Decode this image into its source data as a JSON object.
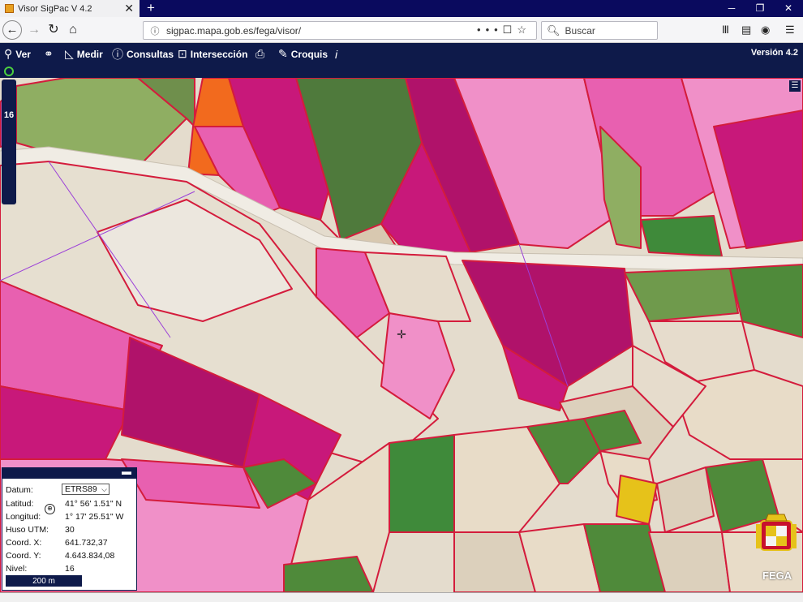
{
  "browser": {
    "tab_title": "Visor SigPac V 4.2",
    "tab_close": "✕",
    "new_tab": "+",
    "url": "sigpac.mapa.gob.es/fega/visor/",
    "search_placeholder": "Buscar",
    "window_controls": [
      "─",
      "❐",
      "✕"
    ]
  },
  "toolbar": {
    "items": [
      {
        "label": "Ver",
        "icon": "search-icon"
      },
      {
        "label": "",
        "icon": "binoculars-icon"
      },
      {
        "label": "Medir",
        "icon": "measure-icon"
      },
      {
        "label": "Consultas",
        "icon": "info-icon"
      },
      {
        "label": "Intersección",
        "icon": "intersection-icon"
      },
      {
        "label": "",
        "icon": "print-icon"
      },
      {
        "label": "Croquis",
        "icon": "pencil-icon"
      },
      {
        "label": "",
        "icon": "italic-info-icon"
      }
    ],
    "version": "Versión 4.2"
  },
  "map": {
    "zoom_level": "16",
    "colors": {
      "parcel_border": "#d41c3c",
      "magenta": "#c8187a",
      "pink": "#e860b0",
      "light_pink": "#f090c8",
      "orange": "#f26a1e",
      "yellow": "#e6c21a",
      "green": "#4f8a3a",
      "beige": "#e8dcc8"
    }
  },
  "coords": {
    "datum_label": "Datum:",
    "datum_value": "ETRS89",
    "lat_label": "Latitud:",
    "lat_value": "41° 56' 1.51\" N",
    "lon_label": "Longitud:",
    "lon_value": "1° 17' 25.51\" W",
    "huso_label": "Huso UTM:",
    "huso_value": "30",
    "x_label": "Coord. X:",
    "x_value": "641.732,37",
    "y_label": "Coord. Y:",
    "y_value": "4.643.834,08",
    "nivel_label": "Nivel:",
    "nivel_value": "16",
    "scale": "200 m"
  },
  "branding": {
    "logo_text": "FEGA"
  }
}
